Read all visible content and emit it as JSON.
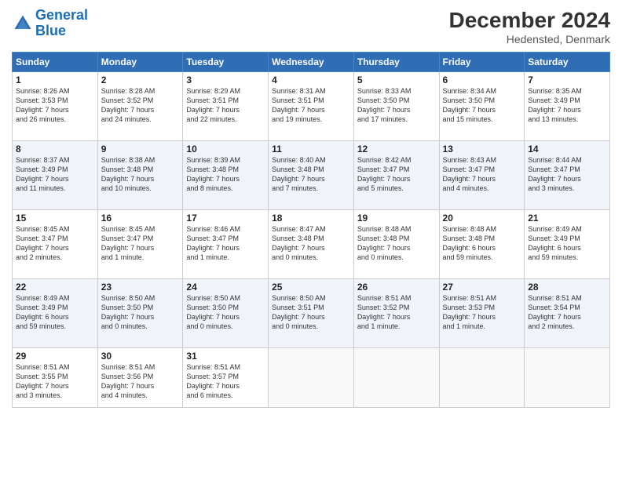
{
  "header": {
    "logo_line1": "General",
    "logo_line2": "Blue",
    "month": "December 2024",
    "location": "Hedensted, Denmark"
  },
  "weekdays": [
    "Sunday",
    "Monday",
    "Tuesday",
    "Wednesday",
    "Thursday",
    "Friday",
    "Saturday"
  ],
  "weeks": [
    [
      {
        "day": "1",
        "info": "Sunrise: 8:26 AM\nSunset: 3:53 PM\nDaylight: 7 hours\nand 26 minutes."
      },
      {
        "day": "2",
        "info": "Sunrise: 8:28 AM\nSunset: 3:52 PM\nDaylight: 7 hours\nand 24 minutes."
      },
      {
        "day": "3",
        "info": "Sunrise: 8:29 AM\nSunset: 3:51 PM\nDaylight: 7 hours\nand 22 minutes."
      },
      {
        "day": "4",
        "info": "Sunrise: 8:31 AM\nSunset: 3:51 PM\nDaylight: 7 hours\nand 19 minutes."
      },
      {
        "day": "5",
        "info": "Sunrise: 8:33 AM\nSunset: 3:50 PM\nDaylight: 7 hours\nand 17 minutes."
      },
      {
        "day": "6",
        "info": "Sunrise: 8:34 AM\nSunset: 3:50 PM\nDaylight: 7 hours\nand 15 minutes."
      },
      {
        "day": "7",
        "info": "Sunrise: 8:35 AM\nSunset: 3:49 PM\nDaylight: 7 hours\nand 13 minutes."
      }
    ],
    [
      {
        "day": "8",
        "info": "Sunrise: 8:37 AM\nSunset: 3:49 PM\nDaylight: 7 hours\nand 11 minutes."
      },
      {
        "day": "9",
        "info": "Sunrise: 8:38 AM\nSunset: 3:48 PM\nDaylight: 7 hours\nand 10 minutes."
      },
      {
        "day": "10",
        "info": "Sunrise: 8:39 AM\nSunset: 3:48 PM\nDaylight: 7 hours\nand 8 minutes."
      },
      {
        "day": "11",
        "info": "Sunrise: 8:40 AM\nSunset: 3:48 PM\nDaylight: 7 hours\nand 7 minutes."
      },
      {
        "day": "12",
        "info": "Sunrise: 8:42 AM\nSunset: 3:47 PM\nDaylight: 7 hours\nand 5 minutes."
      },
      {
        "day": "13",
        "info": "Sunrise: 8:43 AM\nSunset: 3:47 PM\nDaylight: 7 hours\nand 4 minutes."
      },
      {
        "day": "14",
        "info": "Sunrise: 8:44 AM\nSunset: 3:47 PM\nDaylight: 7 hours\nand 3 minutes."
      }
    ],
    [
      {
        "day": "15",
        "info": "Sunrise: 8:45 AM\nSunset: 3:47 PM\nDaylight: 7 hours\nand 2 minutes."
      },
      {
        "day": "16",
        "info": "Sunrise: 8:45 AM\nSunset: 3:47 PM\nDaylight: 7 hours\nand 1 minute."
      },
      {
        "day": "17",
        "info": "Sunrise: 8:46 AM\nSunset: 3:47 PM\nDaylight: 7 hours\nand 1 minute."
      },
      {
        "day": "18",
        "info": "Sunrise: 8:47 AM\nSunset: 3:48 PM\nDaylight: 7 hours\nand 0 minutes."
      },
      {
        "day": "19",
        "info": "Sunrise: 8:48 AM\nSunset: 3:48 PM\nDaylight: 7 hours\nand 0 minutes."
      },
      {
        "day": "20",
        "info": "Sunrise: 8:48 AM\nSunset: 3:48 PM\nDaylight: 6 hours\nand 59 minutes."
      },
      {
        "day": "21",
        "info": "Sunrise: 8:49 AM\nSunset: 3:49 PM\nDaylight: 6 hours\nand 59 minutes."
      }
    ],
    [
      {
        "day": "22",
        "info": "Sunrise: 8:49 AM\nSunset: 3:49 PM\nDaylight: 6 hours\nand 59 minutes."
      },
      {
        "day": "23",
        "info": "Sunrise: 8:50 AM\nSunset: 3:50 PM\nDaylight: 7 hours\nand 0 minutes."
      },
      {
        "day": "24",
        "info": "Sunrise: 8:50 AM\nSunset: 3:50 PM\nDaylight: 7 hours\nand 0 minutes."
      },
      {
        "day": "25",
        "info": "Sunrise: 8:50 AM\nSunset: 3:51 PM\nDaylight: 7 hours\nand 0 minutes."
      },
      {
        "day": "26",
        "info": "Sunrise: 8:51 AM\nSunset: 3:52 PM\nDaylight: 7 hours\nand 1 minute."
      },
      {
        "day": "27",
        "info": "Sunrise: 8:51 AM\nSunset: 3:53 PM\nDaylight: 7 hours\nand 1 minute."
      },
      {
        "day": "28",
        "info": "Sunrise: 8:51 AM\nSunset: 3:54 PM\nDaylight: 7 hours\nand 2 minutes."
      }
    ],
    [
      {
        "day": "29",
        "info": "Sunrise: 8:51 AM\nSunset: 3:55 PM\nDaylight: 7 hours\nand 3 minutes."
      },
      {
        "day": "30",
        "info": "Sunrise: 8:51 AM\nSunset: 3:56 PM\nDaylight: 7 hours\nand 4 minutes."
      },
      {
        "day": "31",
        "info": "Sunrise: 8:51 AM\nSunset: 3:57 PM\nDaylight: 7 hours\nand 6 minutes."
      },
      {
        "day": "",
        "info": ""
      },
      {
        "day": "",
        "info": ""
      },
      {
        "day": "",
        "info": ""
      },
      {
        "day": "",
        "info": ""
      }
    ]
  ]
}
